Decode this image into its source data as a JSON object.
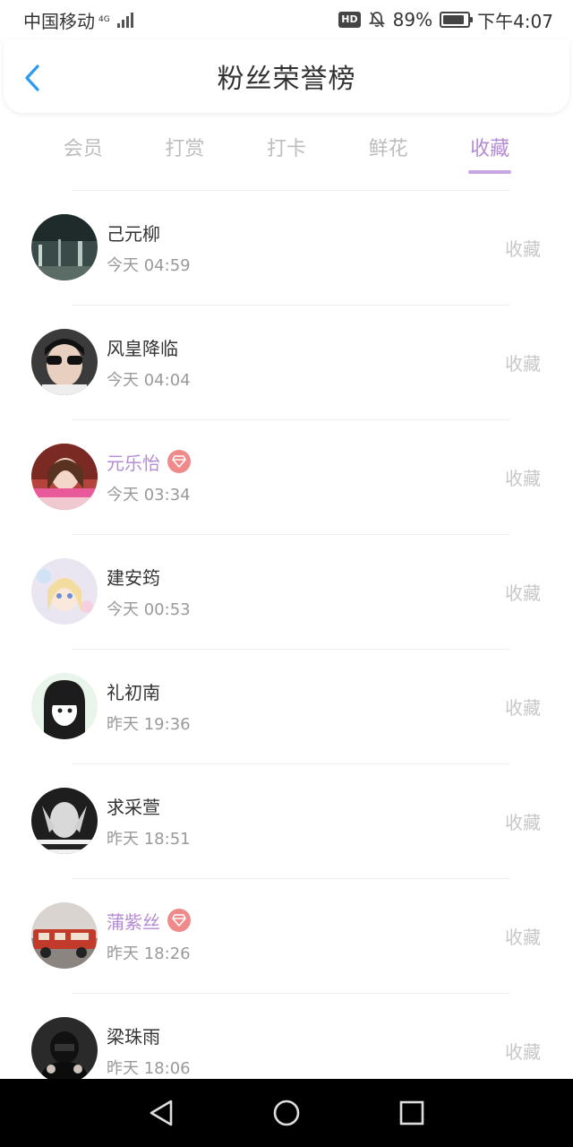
{
  "status_bar": {
    "carrier": "中国移动",
    "network_type": "4G",
    "hd_label": "HD",
    "battery_percent_text": "89%",
    "battery_level": 0.89,
    "time": "下午4:07"
  },
  "header": {
    "title": "粉丝荣誉榜"
  },
  "tabs": [
    {
      "label": "会员",
      "active": false
    },
    {
      "label": "打赏",
      "active": false
    },
    {
      "label": "打卡",
      "active": false
    },
    {
      "label": "鲜花",
      "active": false
    },
    {
      "label": "收藏",
      "active": true
    }
  ],
  "colors": {
    "accent": "#b58bd6",
    "badge": "#f08a8a",
    "muted": "#c8c8c8"
  },
  "fans": [
    {
      "name": "己元柳",
      "time": "今天 04:59",
      "action": "收藏",
      "vip": false
    },
    {
      "name": "风皇降临",
      "time": "今天 04:04",
      "action": "收藏",
      "vip": false
    },
    {
      "name": "元乐怡",
      "time": "今天 03:34",
      "action": "收藏",
      "vip": true
    },
    {
      "name": "建安筠",
      "time": "今天 00:53",
      "action": "收藏",
      "vip": false
    },
    {
      "name": "礼初南",
      "time": "昨天 19:36",
      "action": "收藏",
      "vip": false
    },
    {
      "name": "求采萱",
      "time": "昨天 18:51",
      "action": "收藏",
      "vip": false
    },
    {
      "name": "蒲紫丝",
      "time": "昨天 18:26",
      "action": "收藏",
      "vip": true
    },
    {
      "name": "梁珠雨",
      "time": "昨天 18:06",
      "action": "收藏",
      "vip": false
    }
  ],
  "icons": {
    "back": "chevron-left-icon",
    "vip_badge": "diamond-icon",
    "nav": [
      "back-triangle-icon",
      "home-circle-icon",
      "recents-square-icon"
    ]
  }
}
